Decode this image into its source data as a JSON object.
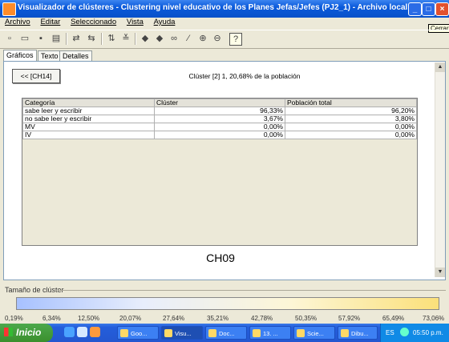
{
  "window": {
    "title": "Visualizador de clústeres - Clustering nivel educativo de los Planes Jefas/Jefes (PJ2_1) - Archivo local: general I...",
    "tooltip": "Cerrar"
  },
  "menu": [
    "Archivo",
    "Editar",
    "Seleccionado",
    "Vista",
    "Ayuda"
  ],
  "toolbar_icons": [
    "new-icon",
    "open-icon",
    "save-icon",
    "print-icon",
    "redo-icon",
    "undo-icon",
    "sort-icon",
    "filter-icon",
    "back-icon",
    "forward-icon",
    "binoculars-icon",
    "wand-icon",
    "zoom-in-icon",
    "zoom-out-icon",
    "help-icon"
  ],
  "tabs": [
    {
      "label": "Gráficos",
      "active": true
    },
    {
      "label": "Texto",
      "active": false
    },
    {
      "label": "Detalles",
      "active": false
    }
  ],
  "content": {
    "back_button": "<< [CH14]",
    "cluster_info": "Clúster [2] 1, 20,68% de la población",
    "table": {
      "headers": [
        "Categoría",
        "Clúster",
        "Población total"
      ],
      "rows": [
        [
          "sabe leer y escribir",
          "96,33%",
          "96,20%"
        ],
        [
          "no sabe leer y escribir",
          "3,67%",
          "3,80%"
        ],
        [
          "MV",
          "0,00%",
          "0,00%"
        ],
        [
          "IV",
          "0,00%",
          "0,00%"
        ]
      ]
    },
    "node_code": "CH09"
  },
  "cluster_size": {
    "label": "Tamaño de clúster",
    "ticks": [
      "0,19%",
      "6,34%",
      "12,50%",
      "20,07%",
      "27,64%",
      "35,21%",
      "42,78%",
      "50,35%",
      "57,92%",
      "65,49%",
      "73,06%"
    ]
  },
  "taskbar": {
    "start": "Inicio",
    "tasks": [
      "Goo...",
      "Visu...",
      "Doc...",
      "13. ...",
      "Scie...",
      "Dibu..."
    ],
    "lang": "ES",
    "clock": "05:50 p.m."
  }
}
